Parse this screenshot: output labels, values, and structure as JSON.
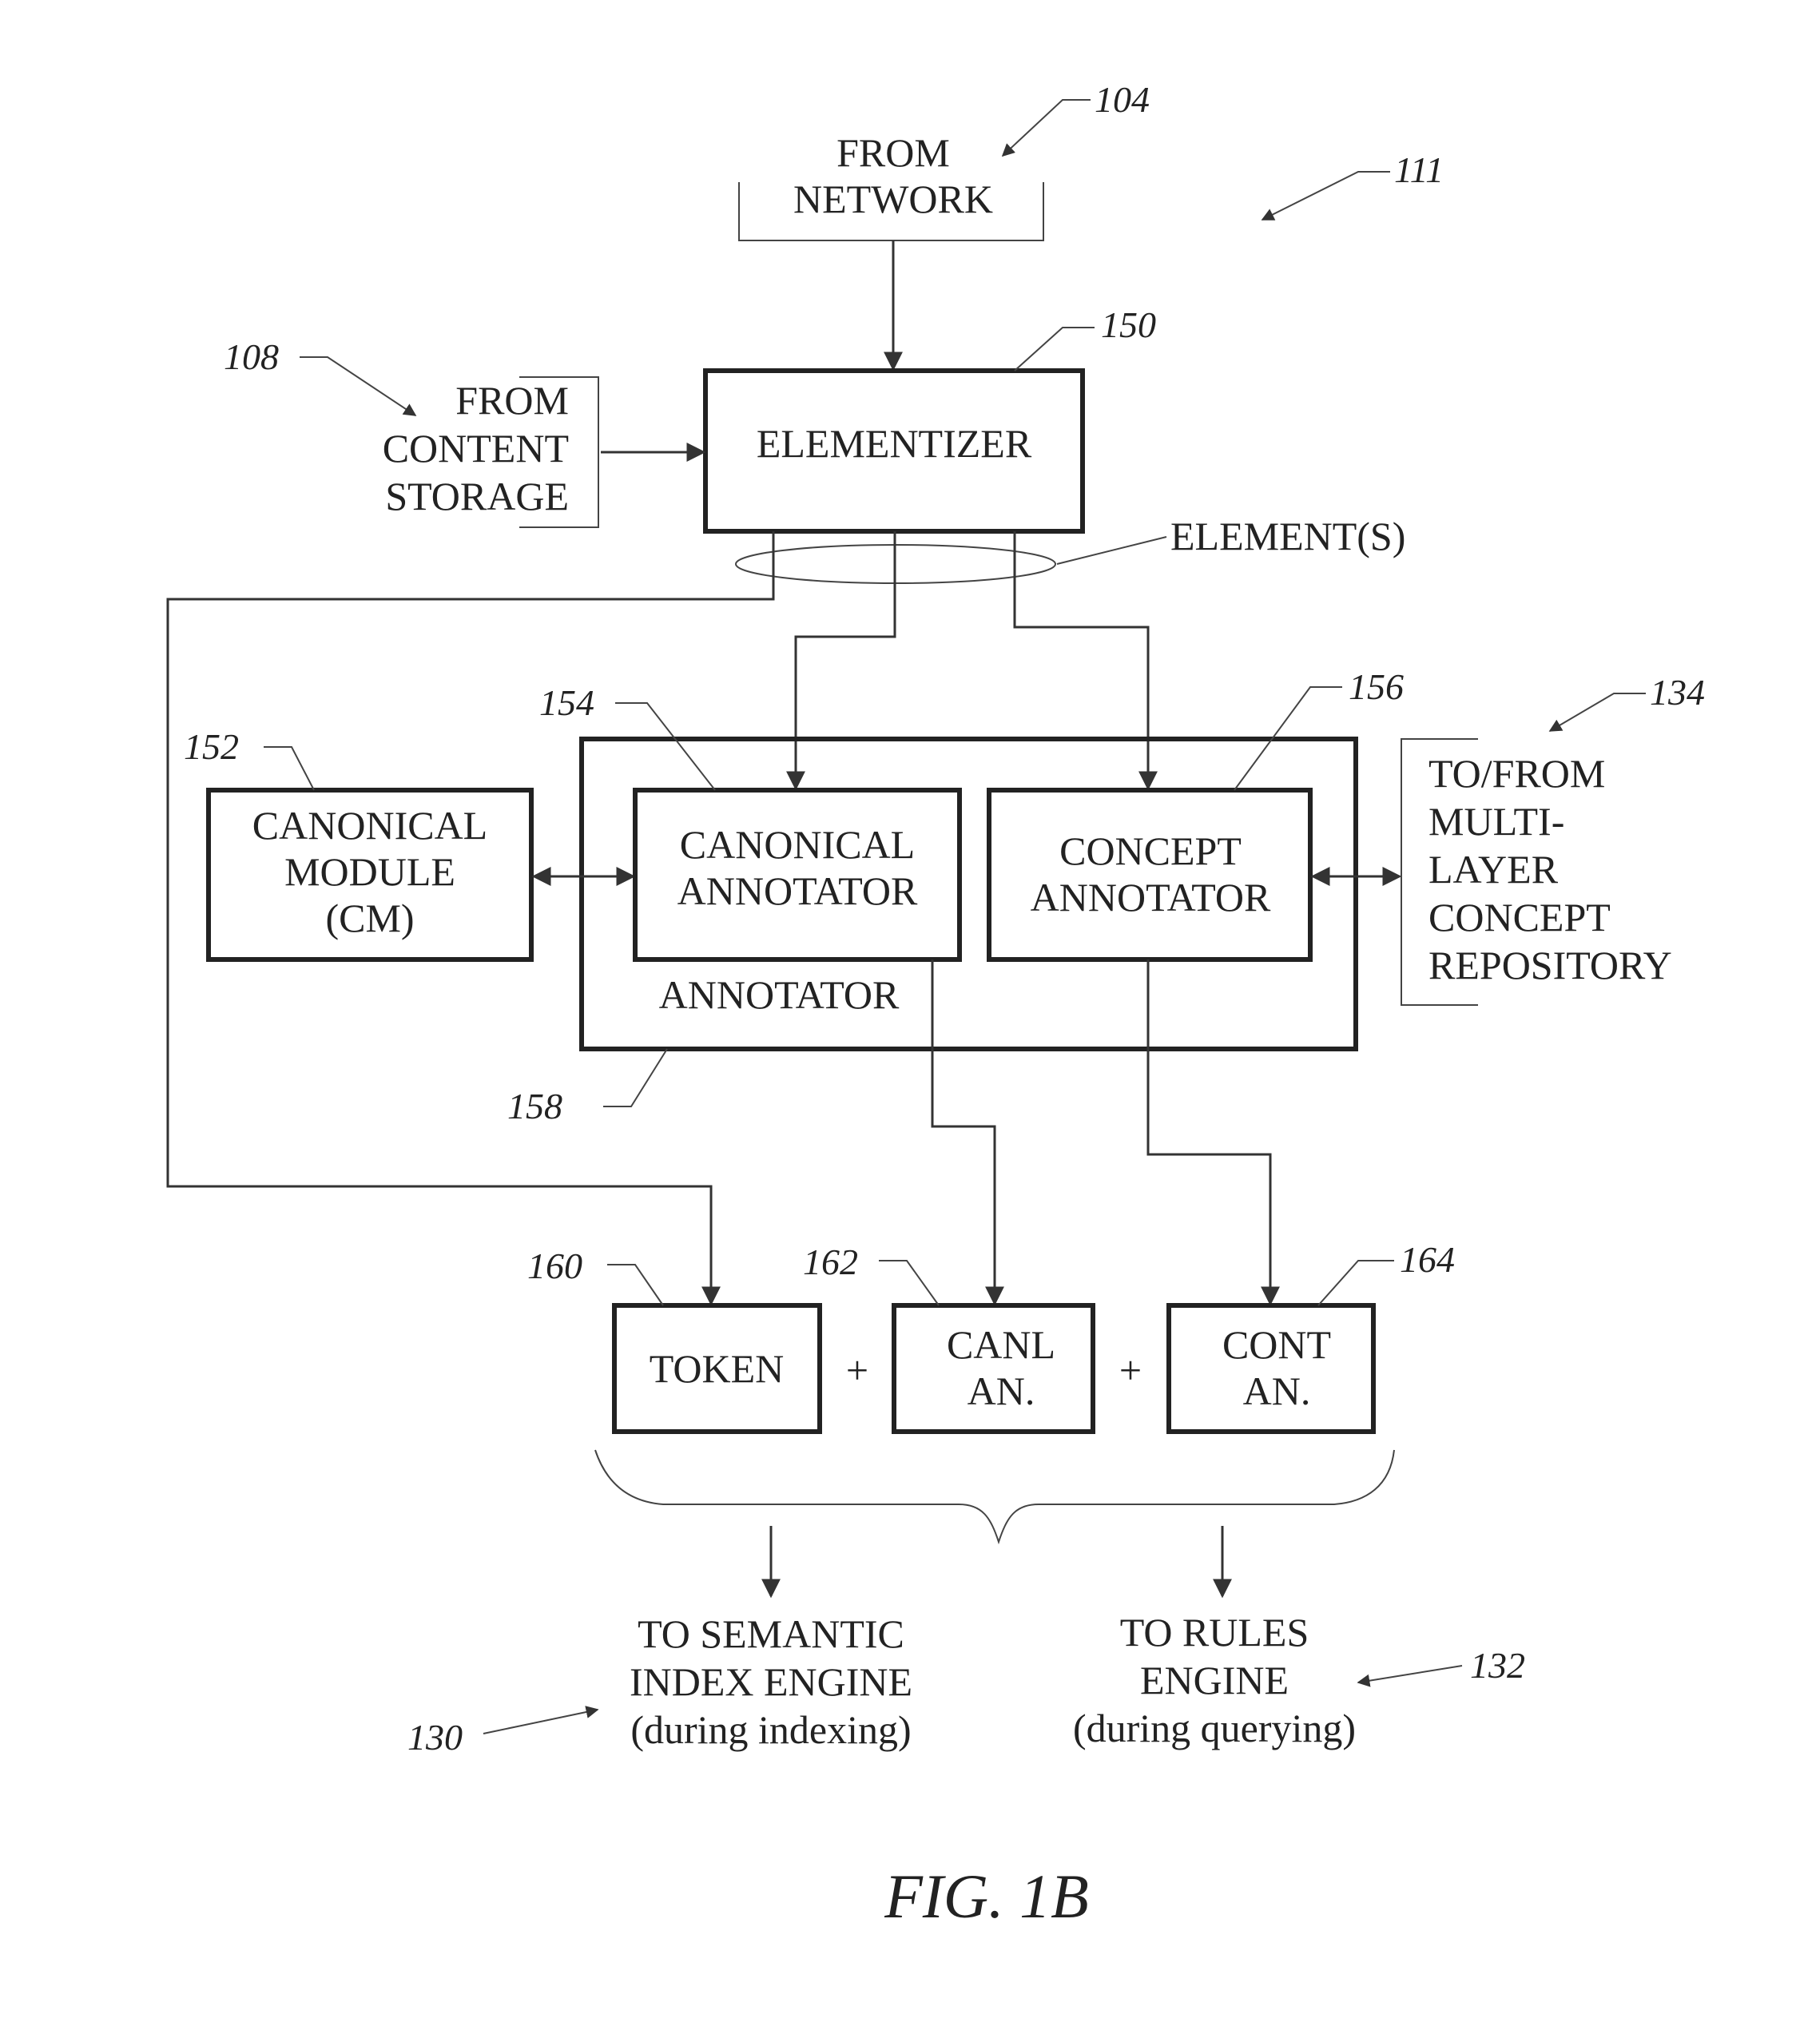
{
  "figure_label": "FIG. 1B",
  "refs": {
    "network": "104",
    "system": "111",
    "content_storage": "108",
    "elementizer": "150",
    "canonical_module": "152",
    "canonical_annotator": "154",
    "concept_annotator": "156",
    "annotator": "158",
    "repository": "134",
    "token": "160",
    "canl": "162",
    "cont": "164",
    "semantic_index": "130",
    "rules_engine": "132"
  },
  "inputs": {
    "network": [
      "FROM",
      "NETWORK"
    ],
    "content_storage": [
      "FROM",
      "CONTENT",
      "STORAGE"
    ]
  },
  "elementizer": "ELEMENTIZER",
  "elements_label": "ELEMENT(S)",
  "canonical_module": [
    "CANONICAL",
    "MODULE",
    "(CM)"
  ],
  "canonical_annotator": [
    "CANONICAL",
    "ANNOTATOR"
  ],
  "concept_annotator": [
    "CONCEPT",
    "ANNOTATOR"
  ],
  "annotator_label": "ANNOTATOR",
  "repository": [
    "TO/FROM",
    "MULTI-",
    "LAYER",
    "CONCEPT",
    "REPOSITORY"
  ],
  "outputs": {
    "token": "TOKEN",
    "canl": [
      "CANL",
      "AN."
    ],
    "cont": [
      "CONT",
      "AN."
    ],
    "plus": "+"
  },
  "destinations": {
    "semantic": [
      "TO SEMANTIC",
      "INDEX ENGINE",
      "(during indexing)"
    ],
    "rules": [
      "TO RULES",
      "ENGINE",
      "(during querying)"
    ]
  }
}
